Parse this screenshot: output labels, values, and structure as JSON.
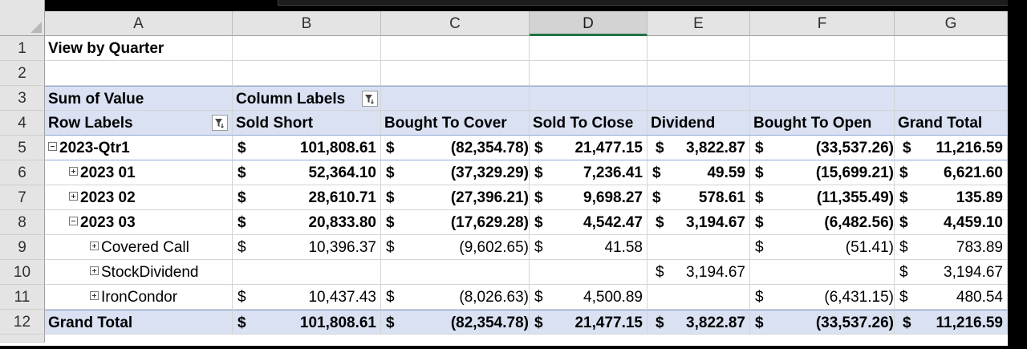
{
  "columns": [
    "A",
    "B",
    "C",
    "D",
    "E",
    "F",
    "G"
  ],
  "selected_column": "D",
  "row_numbers": [
    "1",
    "2",
    "3",
    "4",
    "5",
    "6",
    "7",
    "8",
    "9",
    "10",
    "11",
    "12"
  ],
  "cells": {
    "title": "View by Quarter",
    "sum_of_value": "Sum of Value",
    "column_labels": "Column Labels",
    "row_labels": "Row Labels",
    "headers": [
      "Sold Short",
      "Bought To Cover",
      "Sold To Close",
      "Dividend",
      "Bought To Open",
      "Grand Total"
    ]
  },
  "currency_symbol": "$",
  "pivot_rows": [
    {
      "label": "2023-Qtr1",
      "expander": "minus",
      "values": [
        "101,808.61",
        "(82,354.78)",
        "21,477.15",
        "3,822.87",
        "(33,537.26)",
        "11,216.59"
      ]
    },
    {
      "label": "2023 01",
      "expander": "plus",
      "values": [
        "52,364.10",
        "(37,329.29)",
        "7,236.41",
        "49.59",
        "(15,699.21)",
        "6,621.60"
      ]
    },
    {
      "label": "2023 02",
      "expander": "plus",
      "values": [
        "28,610.71",
        "(27,396.21)",
        "9,698.27",
        "578.61",
        "(11,355.49)",
        "135.89"
      ]
    },
    {
      "label": "2023 03",
      "expander": "minus",
      "values": [
        "20,833.80",
        "(17,629.28)",
        "4,542.47",
        "3,194.67",
        "(6,482.56)",
        "4,459.10"
      ]
    },
    {
      "label": "Covered Call",
      "expander": "plus",
      "values": [
        "10,396.37",
        "(9,602.65)",
        "41.58",
        "",
        "(51.41)",
        "783.89"
      ]
    },
    {
      "label": "StockDividend",
      "expander": "plus",
      "values": [
        "",
        "",
        "",
        "3,194.67",
        "",
        "3,194.67"
      ]
    },
    {
      "label": "IronCondor",
      "expander": "plus",
      "values": [
        "10,437.43",
        "(8,026.63)",
        "4,500.89",
        "",
        "(6,431.15)",
        "480.54"
      ]
    },
    {
      "label": "Grand Total",
      "expander": "none",
      "values": [
        "101,808.61",
        "(82,354.78)",
        "21,477.15",
        "3,822.87",
        "(33,537.26)",
        "11,216.59"
      ]
    }
  ],
  "icons": {
    "column_labels_filter": "filter-active-icon",
    "row_labels_filter": "filter-active-icon",
    "expand": "plus-box-icon",
    "collapse": "minus-box-icon"
  },
  "colors": {
    "pivot_header_fill": "#d9e1f2",
    "selected_column_accent": "#217346"
  }
}
